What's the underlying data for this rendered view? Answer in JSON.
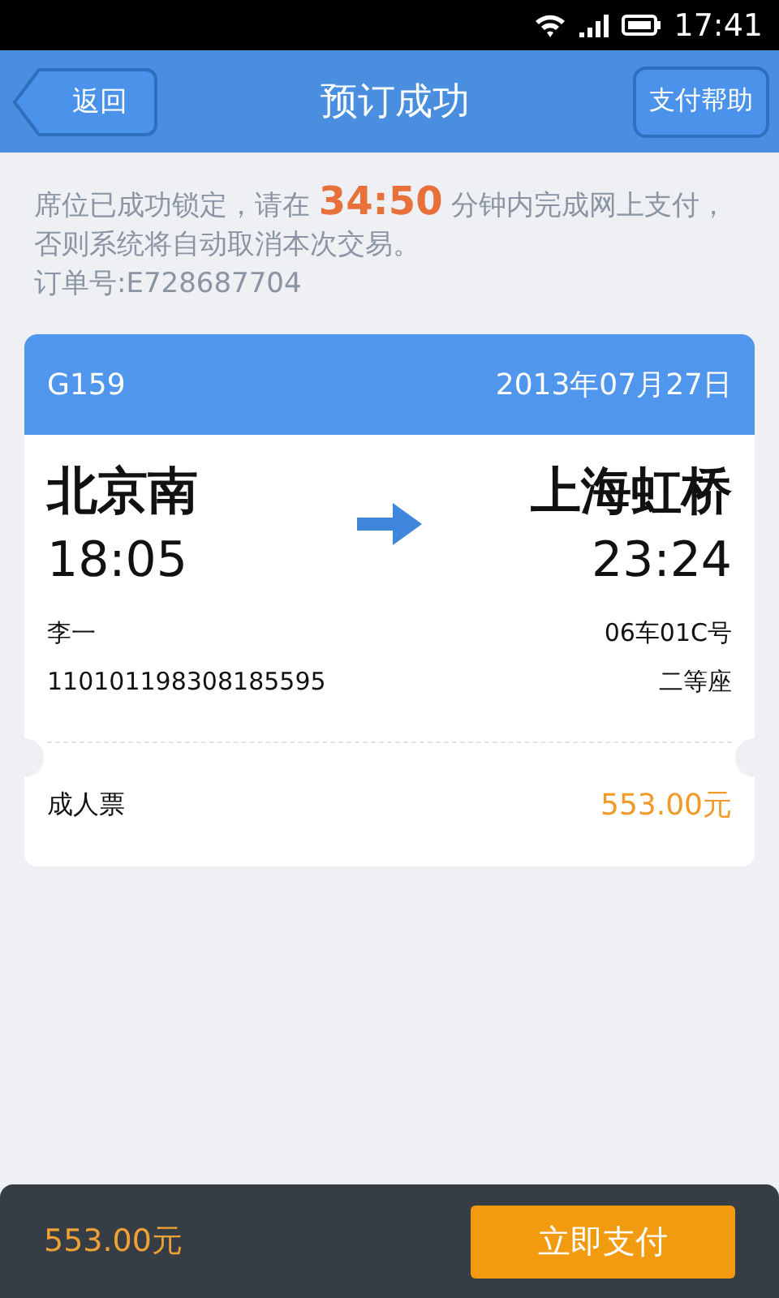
{
  "status_bar": {
    "time": "17:41"
  },
  "header": {
    "back": "返回",
    "title": "预订成功",
    "help": "支付帮助"
  },
  "notice": {
    "text": "席位已成功锁定，请在 **34:50** 分钟内完成网上支付，否则系统将自动取消本次交易。",
    "order": "订单号:E728687704"
  },
  "ticket": {
    "train": "G159",
    "date": "2013年07月27日",
    "from": "北京南",
    "to": "上海虹桥",
    "depart": "18:05",
    "arrive": "23:24",
    "passenger": "李一",
    "id_number": "110101198308185595",
    "seat": "06车01C号",
    "seat_class": "二等座",
    "ticket_type": "成人票",
    "price": "553.00元"
  },
  "footer": {
    "total": "553.00元",
    "pay": "立即支付"
  }
}
